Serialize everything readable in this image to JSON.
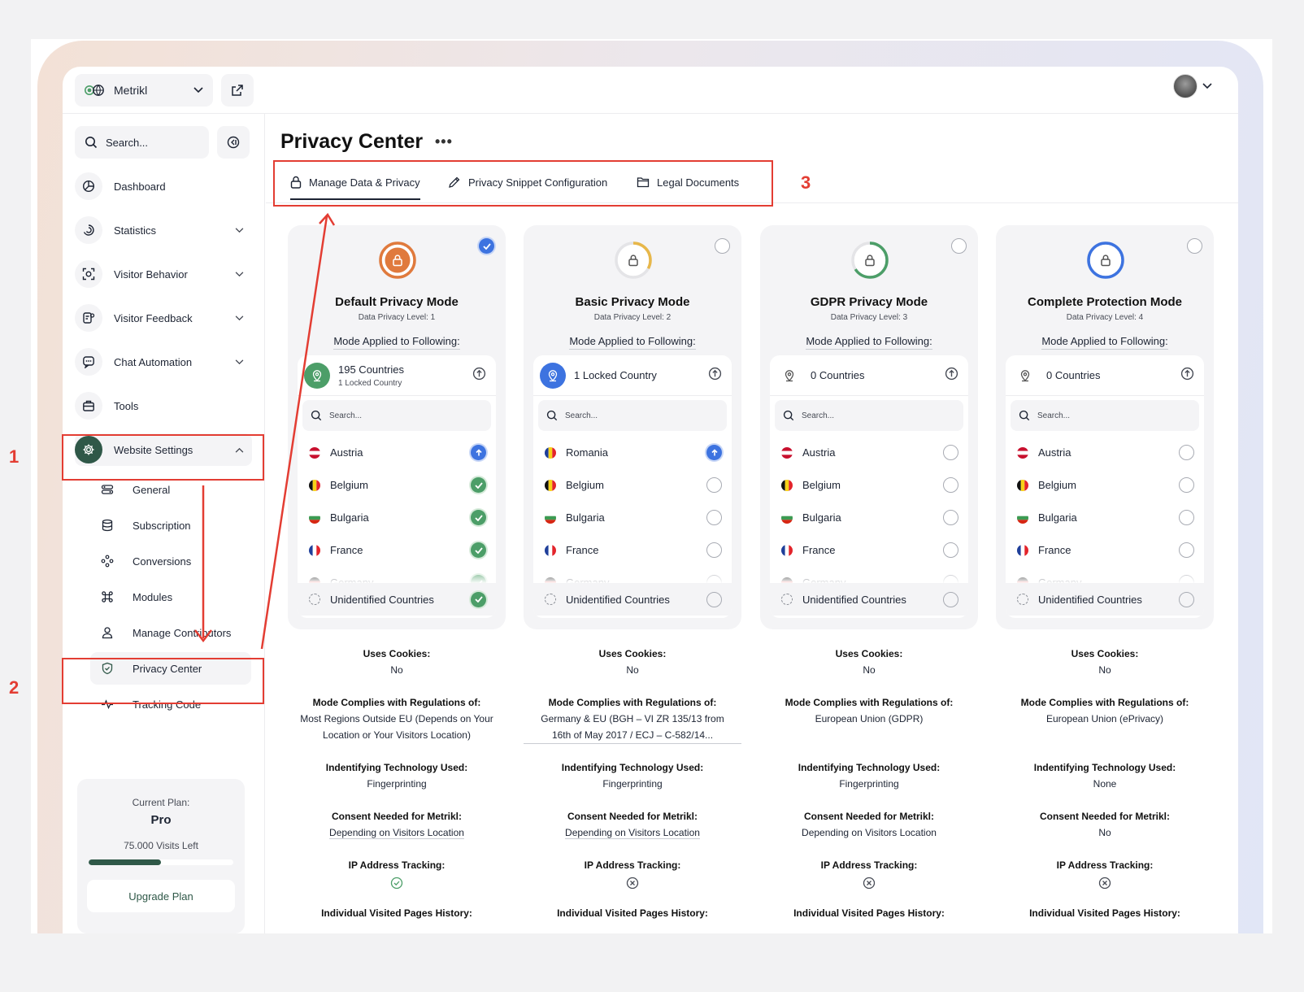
{
  "colors": {
    "accent": "#2f5848",
    "blue": "#3d73e0",
    "green": "#4c9e68",
    "orange": "#e07a3d",
    "yellow": "#e7b74a",
    "annotation": "#e33d33"
  },
  "topbar": {
    "site_name": "Metrikl"
  },
  "sidebar": {
    "search_placeholder": "Search...",
    "items": [
      {
        "label": "Dashboard",
        "icon": "dashboard-icon"
      },
      {
        "label": "Statistics",
        "icon": "statistics-icon"
      },
      {
        "label": "Visitor Behavior",
        "icon": "visitor-behavior-icon"
      },
      {
        "label": "Visitor Feedback",
        "icon": "visitor-feedback-icon"
      },
      {
        "label": "Chat Automation",
        "icon": "chat-icon"
      },
      {
        "label": "Tools",
        "icon": "tools-icon"
      },
      {
        "label": "Website Settings",
        "icon": "gear-icon"
      }
    ],
    "sub_items": [
      {
        "label": "General"
      },
      {
        "label": "Subscription"
      },
      {
        "label": "Conversions"
      },
      {
        "label": "Modules"
      },
      {
        "label": "Manage Contributors"
      },
      {
        "label": "Privacy Center"
      },
      {
        "label": "Tracking Code"
      }
    ],
    "plan": {
      "label": "Current Plan:",
      "value": "Pro",
      "visits": "75.000 Visits Left",
      "usage_fraction": 0.5,
      "upgrade_label": "Upgrade Plan"
    }
  },
  "main": {
    "title": "Privacy Center",
    "tabs": [
      {
        "label": "Manage Data & Privacy"
      },
      {
        "label": "Privacy Snippet Configuration"
      },
      {
        "label": "Legal Documents"
      }
    ]
  },
  "applied_label": "Mode Applied to Following:",
  "search_placeholder": "Search...",
  "unidentified_label": "Unidentified Countries",
  "modes": [
    {
      "title": "Default Privacy Mode",
      "level": "Data Privacy Level: 1",
      "selected": true,
      "count_main": "195 Countries",
      "count_sub": "1 Locked Country",
      "countries": [
        "Austria",
        "Belgium",
        "Bulgaria",
        "France",
        "Germany"
      ],
      "cookies_label": "Uses Cookies:",
      "cookies": "No",
      "regulations_label": "Mode Complies with Regulations of:",
      "regulations": "Most Regions Outside EU (Depends on Your Location or Your Visitors Location)",
      "tech_label": "Indentifying Technology Used:",
      "tech": "Fingerprinting",
      "consent_label": "Consent Needed for Metrikl:",
      "consent": "Depending on Visitors Location",
      "ip_label": "IP Address Tracking:",
      "history_label": "Individual Visited Pages History:"
    },
    {
      "title": "Basic Privacy Mode",
      "level": "Data Privacy Level: 2",
      "selected": false,
      "count_main": "1 Locked Country",
      "count_sub": "",
      "countries": [
        "Romania",
        "Belgium",
        "Bulgaria",
        "France",
        "Germany"
      ],
      "cookies_label": "Uses Cookies:",
      "cookies": "No",
      "regulations_label": "Mode Complies with Regulations of:",
      "regulations": "Germany & EU (BGH – VI ZR 135/13 from 16th of May 2017 / ECJ – C-582/14...",
      "tech_label": "Indentifying Technology Used:",
      "tech": "Fingerprinting",
      "consent_label": "Consent Needed for Metrikl:",
      "consent": "Depending on Visitors Location",
      "ip_label": "IP Address Tracking:",
      "history_label": "Individual Visited Pages History:"
    },
    {
      "title": "GDPR Privacy Mode",
      "level": "Data Privacy Level: 3",
      "selected": false,
      "count_main": "0 Countries",
      "count_sub": "",
      "countries": [
        "Austria",
        "Belgium",
        "Bulgaria",
        "France",
        "Germany"
      ],
      "cookies_label": "Uses Cookies:",
      "cookies": "No",
      "regulations_label": "Mode Complies with Regulations of:",
      "regulations": "European Union (GDPR)",
      "tech_label": "Indentifying Technology Used:",
      "tech": "Fingerprinting",
      "consent_label": "Consent Needed for Metrikl:",
      "consent": "Depending on Visitors Location",
      "ip_label": "IP Address Tracking:",
      "history_label": "Individual Visited Pages History:"
    },
    {
      "title": "Complete Protection Mode",
      "level": "Data Privacy Level: 4",
      "selected": false,
      "count_main": "0 Countries",
      "count_sub": "",
      "countries": [
        "Austria",
        "Belgium",
        "Bulgaria",
        "France",
        "Germany"
      ],
      "cookies_label": "Uses Cookies:",
      "cookies": "No",
      "regulations_label": "Mode Complies with Regulations of:",
      "regulations": "European Union (ePrivacy)",
      "tech_label": "Indentifying Technology Used:",
      "tech": "None",
      "consent_label": "Consent Needed for Metrikl:",
      "consent": "No",
      "ip_label": "IP Address Tracking:",
      "history_label": "Individual Visited Pages History:"
    }
  ],
  "annotations": {
    "a1": "1",
    "a2": "2",
    "a3": "3"
  }
}
